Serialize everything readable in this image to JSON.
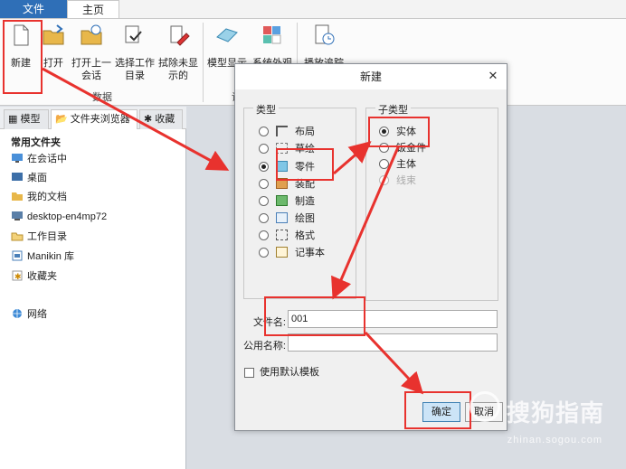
{
  "tabs": {
    "file": "文件",
    "home": "主页"
  },
  "ribbon": {
    "buttons": {
      "new": "新建",
      "open": "打开",
      "open_last_1": "打开上一",
      "open_last_2": "会话",
      "select_wd_1": "选择工作",
      "select_wd_2": "目录",
      "erase_1": "拭除未显",
      "erase_2": "示的",
      "model_display": "模型显示",
      "system_appearance": "系统外观",
      "playback": "播放追踪"
    },
    "group_data": "数据",
    "group_settings": "设"
  },
  "left_panel": {
    "tabs": {
      "model": "模型",
      "folder_browser": "文件夹浏览器",
      "favorites": "收藏"
    },
    "common_folders": "常用文件夹",
    "items": [
      "在会话中",
      "桌面",
      "我的文档",
      "desktop-en4mp72",
      "工作目录",
      "Manikin 库",
      "收藏夹"
    ],
    "network": "网络"
  },
  "dialog": {
    "title": "新建",
    "type_label": "类型",
    "subtype_label": "子类型",
    "types": [
      "布局",
      "草绘",
      "零件",
      "装配",
      "制造",
      "绘图",
      "格式",
      "记事本"
    ],
    "selected_type_index": 2,
    "subtypes": [
      "实体",
      "钣金件",
      "主体",
      "线束"
    ],
    "selected_subtype_index": 0,
    "file_name_label": "文件名:",
    "file_name_value": "001",
    "common_name_label": "公用名称:",
    "common_name_value": "",
    "use_default_template": "使用默认模板",
    "use_default_template_checked": false,
    "ok": "确定",
    "cancel": "取消"
  },
  "watermark": {
    "text": "搜狗指南",
    "url": "zhinan.sogou.com"
  },
  "colors": {
    "accent_blue": "#2f6fb7",
    "annotation_red": "#e8322e"
  }
}
